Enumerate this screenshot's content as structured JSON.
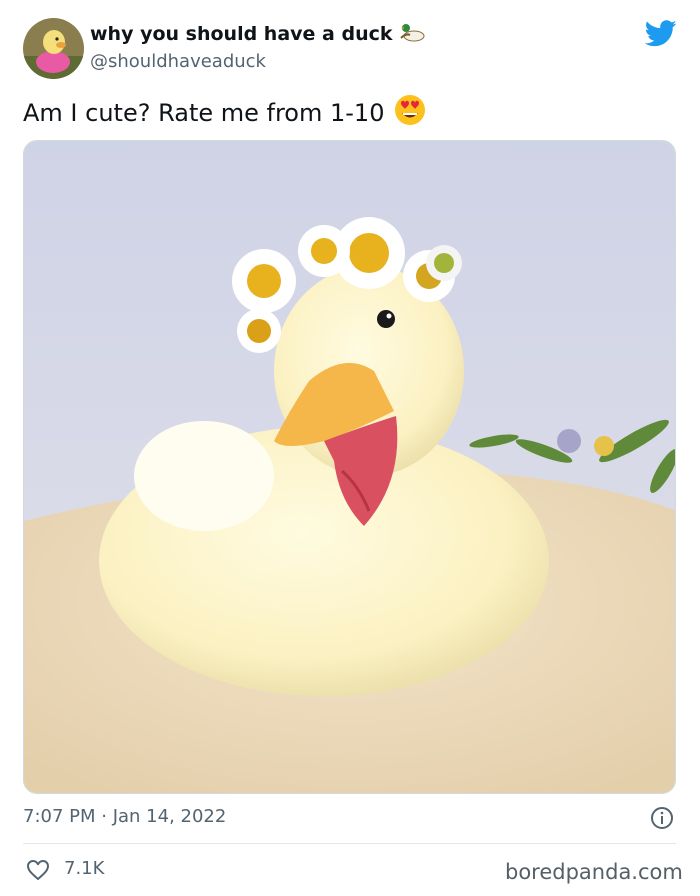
{
  "author": {
    "display_name": "why you should have a duck",
    "handle": "@shouldhaveaduck",
    "name_icon": "duck-emoji",
    "avatar_icon": "duckling-avatar"
  },
  "tweet": {
    "text": "Am I cute? Rate me from 1-10",
    "emoji_icon": "heart-eyes-emoji",
    "timestamp": "7:07 PM · Jan 14, 2022",
    "likes": "7.1K"
  },
  "platform_icon": "twitter-bird-icon",
  "watermark": "boredpanda.com",
  "colors": {
    "twitter_blue": "#1d9bf0",
    "secondary_text": "#536471",
    "border": "#cfd9de"
  }
}
